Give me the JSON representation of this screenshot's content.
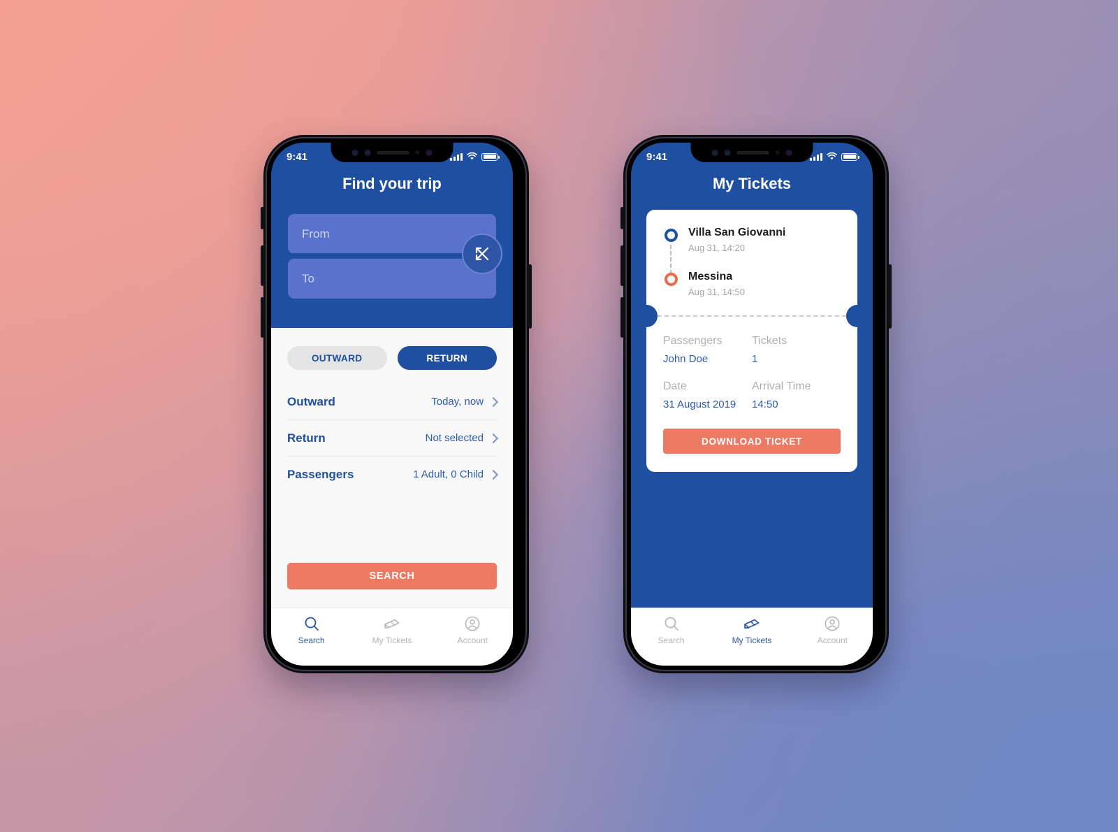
{
  "phones": {
    "left": {
      "status": {
        "time": "9:41",
        "signal_icon": "cellular-bars-icon",
        "wifi_icon": "wifi-icon",
        "battery_icon": "battery-icon"
      },
      "title": "Find your trip",
      "search_form": {
        "from_placeholder": "From",
        "from_value": "",
        "to_placeholder": "To",
        "to_value": "",
        "swap_icon": "swap-arrows-icon"
      },
      "trip_type": {
        "outward_label": "OUTWARD",
        "return_label": "RETURN",
        "selected": "RETURN"
      },
      "rows": [
        {
          "label": "Outward",
          "value": "Today, now"
        },
        {
          "label": "Return",
          "value": "Not selected"
        },
        {
          "label": "Passengers",
          "value": "1 Adult, 0 Child"
        }
      ],
      "search_button": "SEARCH",
      "tabs": [
        {
          "label": "Search",
          "icon": "search-icon",
          "active": true
        },
        {
          "label": "My Tickets",
          "icon": "ticket-icon",
          "active": false
        },
        {
          "label": "Account",
          "icon": "account-icon",
          "active": false
        }
      ]
    },
    "right": {
      "status": {
        "time": "9:41",
        "signal_icon": "cellular-bars-icon",
        "wifi_icon": "wifi-icon",
        "battery_icon": "battery-icon"
      },
      "title": "My Tickets",
      "ticket": {
        "origin": {
          "station": "Villa San Giovanni",
          "time": "Aug 31, 14:20",
          "marker_icon": "origin-circle-icon"
        },
        "destination": {
          "station": "Messina",
          "time": "Aug 31, 14:50",
          "marker_icon": "destination-circle-icon"
        },
        "details": [
          {
            "label": "Passengers",
            "value": "John Doe"
          },
          {
            "label": "Tickets",
            "value": "1"
          },
          {
            "label": "Date",
            "value": "31 August 2019"
          },
          {
            "label": "Arrival Time",
            "value": "14:50"
          }
        ],
        "download_button": "DOWNLOAD TICKET"
      },
      "tabs": [
        {
          "label": "Search",
          "icon": "search-icon",
          "active": false
        },
        {
          "label": "My Tickets",
          "icon": "ticket-icon",
          "active": true
        },
        {
          "label": "Account",
          "icon": "account-icon",
          "active": false
        }
      ]
    }
  },
  "colors": {
    "primary_blue": "#1e4fa0",
    "field_blue": "#5a72cc",
    "accent_coral": "#ed7b63",
    "destination_coral": "#ec6a4d",
    "sheet_bg": "#f8f8f8",
    "muted_text": "#b0b0b0"
  }
}
